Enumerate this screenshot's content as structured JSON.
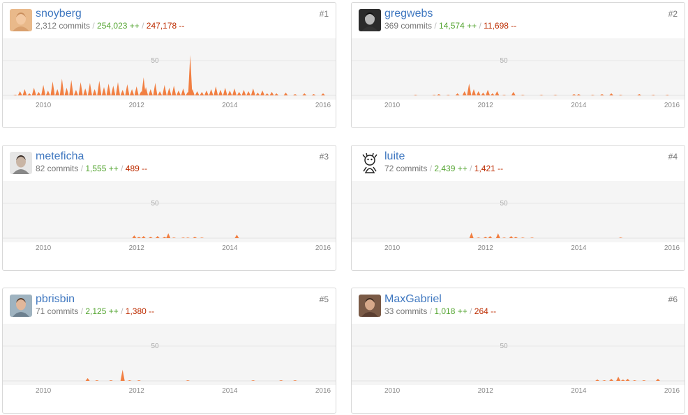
{
  "colors": {
    "accent": "#f17f42",
    "link": "#4078c0",
    "adds": "#55a532",
    "dels": "#bd2c00"
  },
  "stat_suffix": {
    "commits": "commits",
    "adds": "++",
    "dels": "--",
    "separator": "/"
  },
  "contributors": [
    {
      "rank": "#1",
      "name": "snoyberg",
      "commits": "2,312",
      "additions": "254,023",
      "deletions": "247,178",
      "avatar": "avatar-snoyberg",
      "chart_data": {
        "type": "area",
        "ytick": "50",
        "xticks": [
          "2010",
          "2012",
          "2014",
          "2016"
        ],
        "xlim": [
          2009.25,
          2016.15
        ],
        "ylim": [
          0,
          70
        ],
        "points": [
          [
            2009.4,
            1
          ],
          [
            2009.5,
            6
          ],
          [
            2009.6,
            9
          ],
          [
            2009.7,
            3
          ],
          [
            2009.8,
            11
          ],
          [
            2009.9,
            5
          ],
          [
            2010.0,
            15
          ],
          [
            2010.1,
            7
          ],
          [
            2010.2,
            20
          ],
          [
            2010.3,
            9
          ],
          [
            2010.4,
            24
          ],
          [
            2010.5,
            11
          ],
          [
            2010.6,
            22
          ],
          [
            2010.7,
            8
          ],
          [
            2010.8,
            19
          ],
          [
            2010.9,
            10
          ],
          [
            2011.0,
            18
          ],
          [
            2011.1,
            9
          ],
          [
            2011.2,
            21
          ],
          [
            2011.3,
            12
          ],
          [
            2011.4,
            17
          ],
          [
            2011.5,
            14
          ],
          [
            2011.6,
            19
          ],
          [
            2011.7,
            8
          ],
          [
            2011.8,
            16
          ],
          [
            2011.9,
            9
          ],
          [
            2012.0,
            13
          ],
          [
            2012.1,
            6
          ],
          [
            2012.15,
            26
          ],
          [
            2012.2,
            12
          ],
          [
            2012.3,
            9
          ],
          [
            2012.4,
            18
          ],
          [
            2012.5,
            6
          ],
          [
            2012.6,
            15
          ],
          [
            2012.7,
            11
          ],
          [
            2012.8,
            14
          ],
          [
            2012.9,
            7
          ],
          [
            2013.0,
            10
          ],
          [
            2013.1,
            5
          ],
          [
            2013.15,
            58
          ],
          [
            2013.2,
            9
          ],
          [
            2013.3,
            6
          ],
          [
            2013.4,
            5
          ],
          [
            2013.5,
            7
          ],
          [
            2013.6,
            9
          ],
          [
            2013.7,
            13
          ],
          [
            2013.8,
            8
          ],
          [
            2013.9,
            11
          ],
          [
            2014.0,
            7
          ],
          [
            2014.1,
            10
          ],
          [
            2014.2,
            5
          ],
          [
            2014.3,
            8
          ],
          [
            2014.4,
            6
          ],
          [
            2014.5,
            10
          ],
          [
            2014.6,
            4
          ],
          [
            2014.7,
            7
          ],
          [
            2014.8,
            3
          ],
          [
            2014.9,
            5
          ],
          [
            2015.0,
            3
          ],
          [
            2015.2,
            4
          ],
          [
            2015.4,
            2
          ],
          [
            2015.6,
            3
          ],
          [
            2015.8,
            2
          ],
          [
            2016.0,
            3
          ]
        ]
      }
    },
    {
      "rank": "#2",
      "name": "gregwebs",
      "commits": "369",
      "additions": "14,574",
      "deletions": "11,698",
      "avatar": "avatar-gregwebs",
      "chart_data": {
        "type": "area",
        "ytick": "50",
        "xticks": [
          "2010",
          "2012",
          "2014",
          "2016"
        ],
        "xlim": [
          2009.25,
          2016.15
        ],
        "ylim": [
          0,
          70
        ],
        "points": [
          [
            2010.5,
            1
          ],
          [
            2010.9,
            1
          ],
          [
            2011.0,
            2
          ],
          [
            2011.2,
            1
          ],
          [
            2011.4,
            3
          ],
          [
            2011.55,
            6
          ],
          [
            2011.65,
            17
          ],
          [
            2011.75,
            9
          ],
          [
            2011.85,
            6
          ],
          [
            2011.95,
            4
          ],
          [
            2012.05,
            8
          ],
          [
            2012.15,
            3
          ],
          [
            2012.25,
            6
          ],
          [
            2012.4,
            1
          ],
          [
            2012.6,
            5
          ],
          [
            2012.8,
            1
          ],
          [
            2013.2,
            1
          ],
          [
            2013.5,
            1
          ],
          [
            2013.9,
            2
          ],
          [
            2014.0,
            2
          ],
          [
            2014.3,
            1
          ],
          [
            2014.5,
            2
          ],
          [
            2014.7,
            3
          ],
          [
            2014.9,
            1
          ],
          [
            2015.3,
            2
          ],
          [
            2015.6,
            1
          ],
          [
            2015.9,
            1
          ]
        ]
      }
    },
    {
      "rank": "#3",
      "name": "meteficha",
      "commits": "82",
      "additions": "1,555",
      "deletions": "489",
      "avatar": "avatar-meteficha",
      "chart_data": {
        "type": "area",
        "ytick": "50",
        "xticks": [
          "2010",
          "2012",
          "2014",
          "2016"
        ],
        "xlim": [
          2009.25,
          2016.15
        ],
        "ylim": [
          0,
          70
        ],
        "points": [
          [
            2011.95,
            4
          ],
          [
            2012.05,
            2
          ],
          [
            2012.15,
            3
          ],
          [
            2012.3,
            2
          ],
          [
            2012.45,
            3
          ],
          [
            2012.6,
            2
          ],
          [
            2012.68,
            7
          ],
          [
            2012.8,
            1
          ],
          [
            2013.0,
            1
          ],
          [
            2013.1,
            1
          ],
          [
            2013.25,
            2
          ],
          [
            2013.4,
            1
          ],
          [
            2014.15,
            5
          ]
        ]
      }
    },
    {
      "rank": "#4",
      "name": "luite",
      "commits": "72",
      "additions": "2,439",
      "deletions": "1,421",
      "avatar": "avatar-luite",
      "chart_data": {
        "type": "area",
        "ytick": "50",
        "xticks": [
          "2010",
          "2012",
          "2014",
          "2016"
        ],
        "xlim": [
          2009.25,
          2016.15
        ],
        "ylim": [
          0,
          70
        ],
        "points": [
          [
            2011.7,
            8
          ],
          [
            2011.85,
            1
          ],
          [
            2012.0,
            2
          ],
          [
            2012.1,
            3
          ],
          [
            2012.27,
            7
          ],
          [
            2012.4,
            1
          ],
          [
            2012.55,
            3
          ],
          [
            2012.65,
            2
          ],
          [
            2012.8,
            1
          ],
          [
            2013.0,
            1
          ],
          [
            2014.9,
            1
          ]
        ]
      }
    },
    {
      "rank": "#5",
      "name": "pbrisbin",
      "commits": "71",
      "additions": "2,125",
      "deletions": "1,380",
      "avatar": "avatar-pbrisbin",
      "chart_data": {
        "type": "area",
        "ytick": "50",
        "xticks": [
          "2010",
          "2012",
          "2014",
          "2016"
        ],
        "xlim": [
          2009.25,
          2016.15
        ],
        "ylim": [
          0,
          70
        ],
        "points": [
          [
            2010.95,
            4
          ],
          [
            2011.15,
            1
          ],
          [
            2011.45,
            1
          ],
          [
            2011.7,
            16
          ],
          [
            2011.85,
            1
          ],
          [
            2012.05,
            1
          ],
          [
            2013.1,
            1
          ],
          [
            2014.5,
            1
          ],
          [
            2015.1,
            1
          ],
          [
            2015.4,
            1
          ]
        ]
      }
    },
    {
      "rank": "#6",
      "name": "MaxGabriel",
      "commits": "33",
      "additions": "1,018",
      "deletions": "264",
      "avatar": "avatar-maxgabriel",
      "chart_data": {
        "type": "area",
        "ytick": "50",
        "xticks": [
          "2010",
          "2012",
          "2014",
          "2016"
        ],
        "xlim": [
          2009.25,
          2016.15
        ],
        "ylim": [
          0,
          70
        ],
        "points": [
          [
            2014.4,
            2
          ],
          [
            2014.55,
            1
          ],
          [
            2014.7,
            3
          ],
          [
            2014.85,
            6
          ],
          [
            2014.95,
            2
          ],
          [
            2015.05,
            3
          ],
          [
            2015.2,
            1
          ],
          [
            2015.4,
            1
          ],
          [
            2015.7,
            3
          ]
        ]
      }
    }
  ]
}
